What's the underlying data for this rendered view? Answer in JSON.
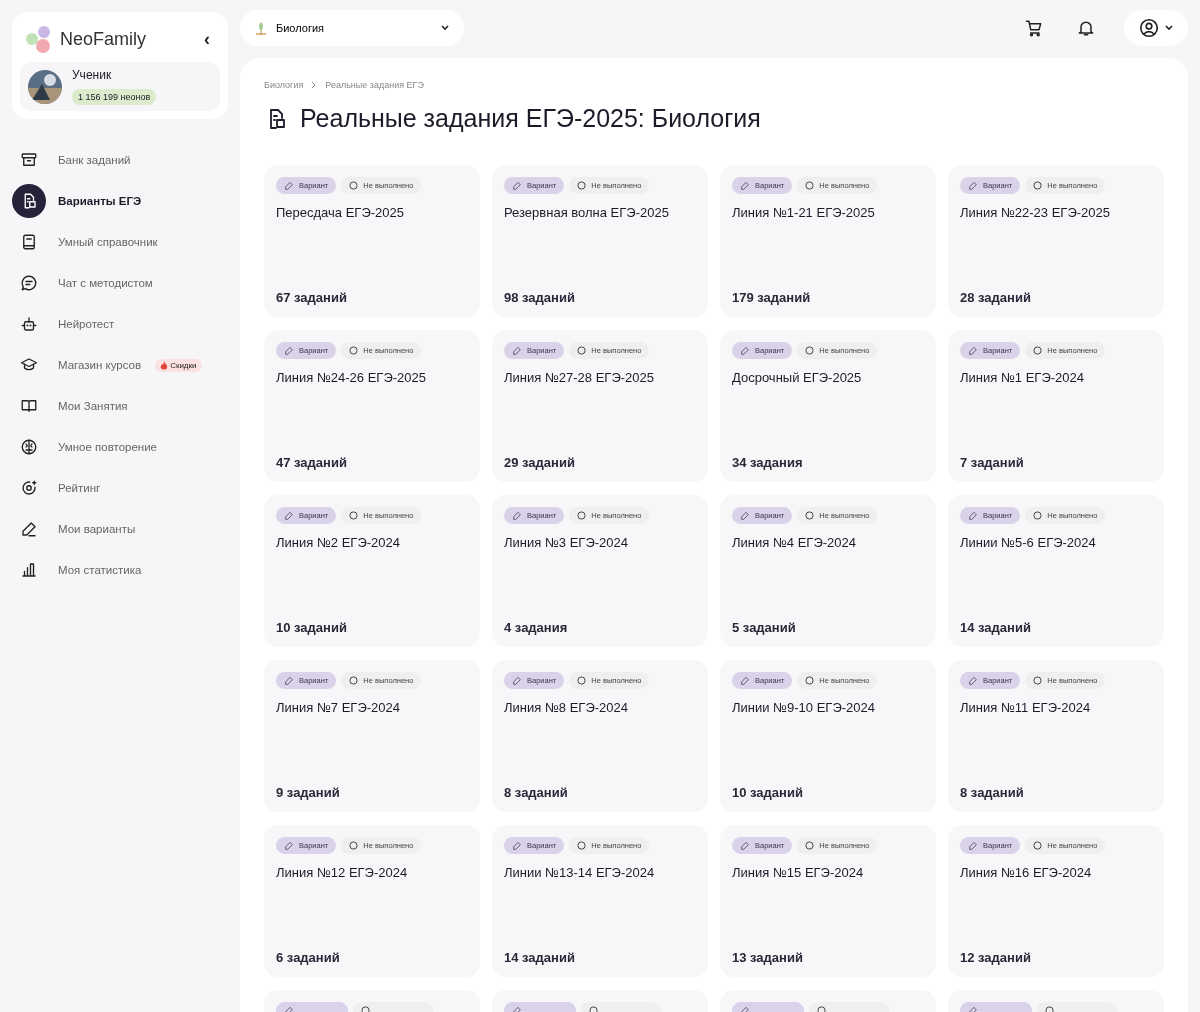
{
  "sidebar": {
    "logo": "NeoFamily",
    "collapse": "‹",
    "user": {
      "name": "Ученик",
      "balance": "1 156 199 неонов"
    },
    "items": [
      {
        "label": "Банк заданий",
        "selected": false
      },
      {
        "label": "Варианты ЕГЭ",
        "selected": true
      },
      {
        "label": "Умный справочник",
        "selected": false
      },
      {
        "label": "Чат с методистом",
        "selected": false
      },
      {
        "label": "Нейротест",
        "selected": false
      },
      {
        "label": "Магазин курсов",
        "selected": false,
        "badge": "Скидки"
      },
      {
        "label": "Мои Занятия",
        "selected": false
      },
      {
        "label": "Умное повторение",
        "selected": false
      },
      {
        "label": "Рейтинг",
        "selected": false
      },
      {
        "label": "Мои варианты",
        "selected": false
      },
      {
        "label": "Моя статистика",
        "selected": false
      }
    ]
  },
  "subject_select": {
    "value": "Биология"
  },
  "breadcrumbs": [
    "Биология",
    "Реальные задания ЕГЭ"
  ],
  "title": "Реальные задания ЕГЭ-2025: Биология",
  "cards": [
    {
      "tag": "Вариант",
      "status": "Не выполнено",
      "done": false,
      "title": "Пересдача ЕГЭ-2025",
      "count": "67 заданий"
    },
    {
      "tag": "Вариант",
      "status": "Не выполнено",
      "done": false,
      "title": "Резервная волна ЕГЭ-2025",
      "count": "98 заданий"
    },
    {
      "tag": "Вариант",
      "status": "Не выполнено",
      "done": false,
      "title": "Линия №1-21 ЕГЭ-2025",
      "count": "179 заданий"
    },
    {
      "tag": "Вариант",
      "status": "Не выполнено",
      "done": false,
      "title": "Линия №22-23 ЕГЭ-2025",
      "count": "28 заданий"
    },
    {
      "tag": "Вариант",
      "status": "Не выполнено",
      "done": false,
      "title": "Линия №24-26 ЕГЭ-2025",
      "count": "47 заданий"
    },
    {
      "tag": "Вариант",
      "status": "Не выполнено",
      "done": false,
      "title": "Линия №27-28 ЕГЭ-2025",
      "count": "29 заданий"
    },
    {
      "tag": "Вариант",
      "status": "Не выполнено",
      "done": false,
      "title": "Досрочный ЕГЭ-2025",
      "count": "34 задания"
    },
    {
      "tag": "Вариант",
      "status": "Не выполнено",
      "done": false,
      "title": "Линия №1 ЕГЭ-2024",
      "count": "7 заданий"
    },
    {
      "tag": "Вариант",
      "status": "Не выполнено",
      "done": false,
      "title": "Линия №2 ЕГЭ-2024",
      "count": "10 заданий"
    },
    {
      "tag": "Вариант",
      "status": "Не выполнено",
      "done": false,
      "title": "Линия №3 ЕГЭ-2024",
      "count": "4 задания"
    },
    {
      "tag": "Вариант",
      "status": "Не выполнено",
      "done": false,
      "title": "Линия №4 ЕГЭ-2024",
      "count": "5 заданий"
    },
    {
      "tag": "Вариант",
      "status": "Не выполнено",
      "done": false,
      "title": "Линии №5-6 ЕГЭ-2024",
      "count": "14 заданий"
    },
    {
      "tag": "Вариант",
      "status": "Не выполнено",
      "done": false,
      "title": "Линия №7 ЕГЭ-2024",
      "count": "9 заданий"
    },
    {
      "tag": "Вариант",
      "status": "Не выполнено",
      "done": false,
      "title": "Линия №8 ЕГЭ-2024",
      "count": "8 заданий"
    },
    {
      "tag": "Вариант",
      "status": "Не выполнено",
      "done": false,
      "title": "Линии №9-10 ЕГЭ-2024",
      "count": "10 заданий"
    },
    {
      "tag": "Вариант",
      "status": "Не выполнено",
      "done": false,
      "title": "Линия №11 ЕГЭ-2024",
      "count": "8 заданий"
    },
    {
      "tag": "Вариант",
      "status": "Не выполнено",
      "done": false,
      "title": "Линия №12 ЕГЭ-2024",
      "count": "6 заданий"
    },
    {
      "tag": "Вариант",
      "status": "Не выполнено",
      "done": false,
      "title": "Линии №13-14 ЕГЭ-2024",
      "count": "14 заданий"
    },
    {
      "tag": "Вариант",
      "status": "Не выполнено",
      "done": false,
      "title": "Линия №15 ЕГЭ-2024",
      "count": "13 заданий"
    },
    {
      "tag": "Вариант",
      "status": "Не выполнено",
      "done": false,
      "title": "Линия №16 ЕГЭ-2024",
      "count": "12 заданий"
    },
    {
      "done": false
    },
    {
      "done": false
    },
    {
      "done": false
    },
    {
      "done": false
    }
  ]
}
